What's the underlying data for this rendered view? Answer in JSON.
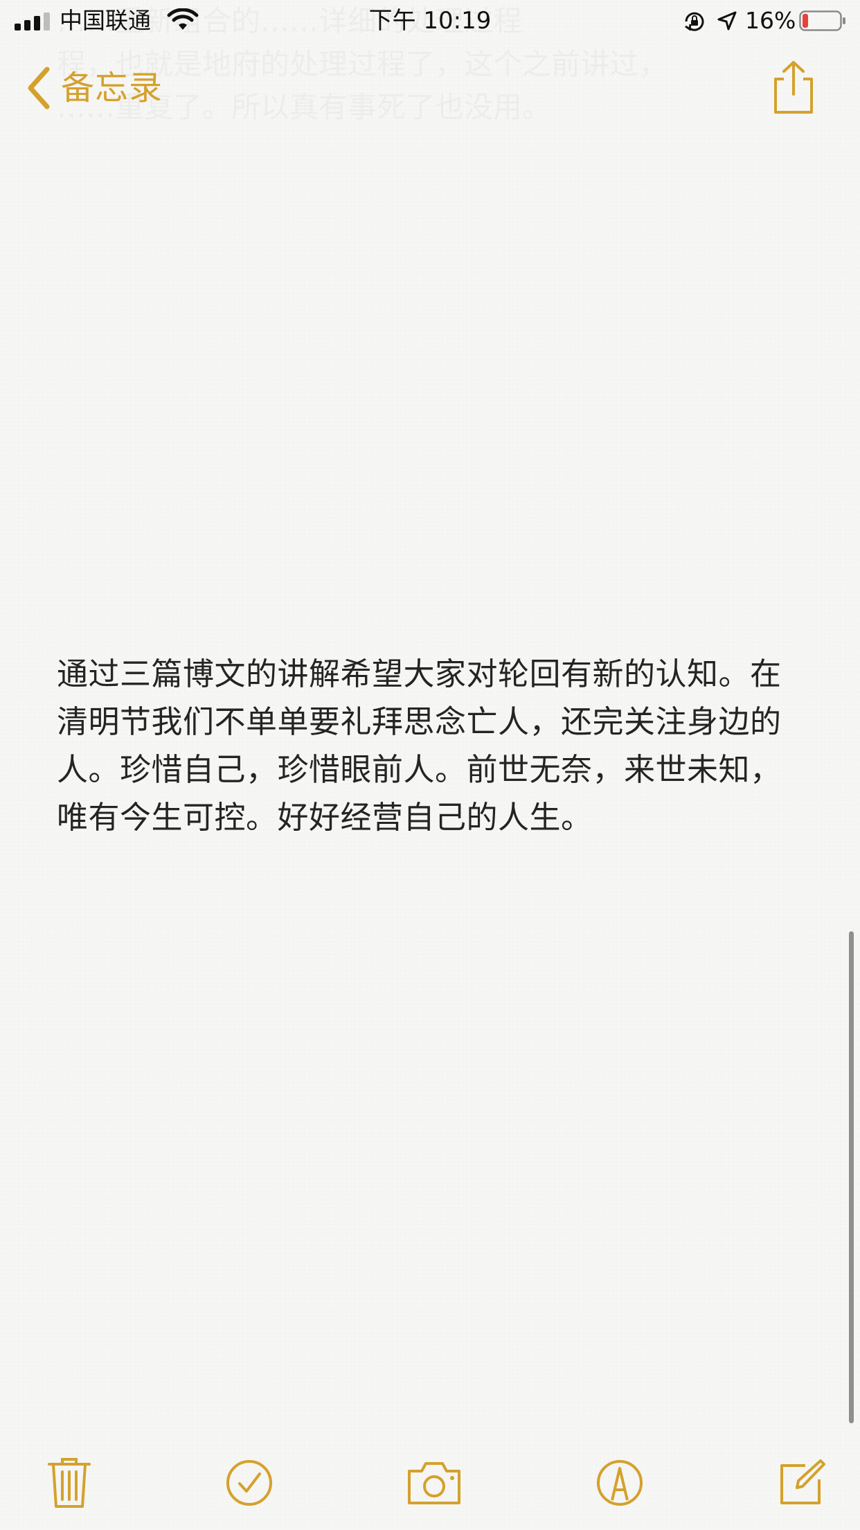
{
  "status_bar": {
    "carrier": "中国联通",
    "time": "下午 10:19",
    "battery_percent": "16%",
    "battery_level": 0.16,
    "signal_bars": 4,
    "signal_bars_active": 3
  },
  "nav": {
    "back_label": "备忘录",
    "ghost_text": "……重新组合的……详细的处理过程\n程，也就是地府的处理过程了，这个之前讲过，\n……重复了。所以真有事死了也没用。"
  },
  "note": {
    "body": "通过三篇博文的讲解希望大家对轮回有新的认知。在清明节我们不单单要礼拜思念亡人，还完关注身边的人。珍惜自己，珍惜眼前人。前世无奈，来世未知，唯有今生可控。好好经营自己的人生。"
  },
  "colors": {
    "accent": "#d4a12d",
    "text": "#242424",
    "battery_low": "#e8413a"
  },
  "icons": {
    "back": "chevron-left-icon",
    "share": "share-icon",
    "trash": "trash-icon",
    "checklist": "checkmark-circle-icon",
    "camera": "camera-icon",
    "markup": "markup-pen-icon",
    "compose": "compose-icon"
  }
}
